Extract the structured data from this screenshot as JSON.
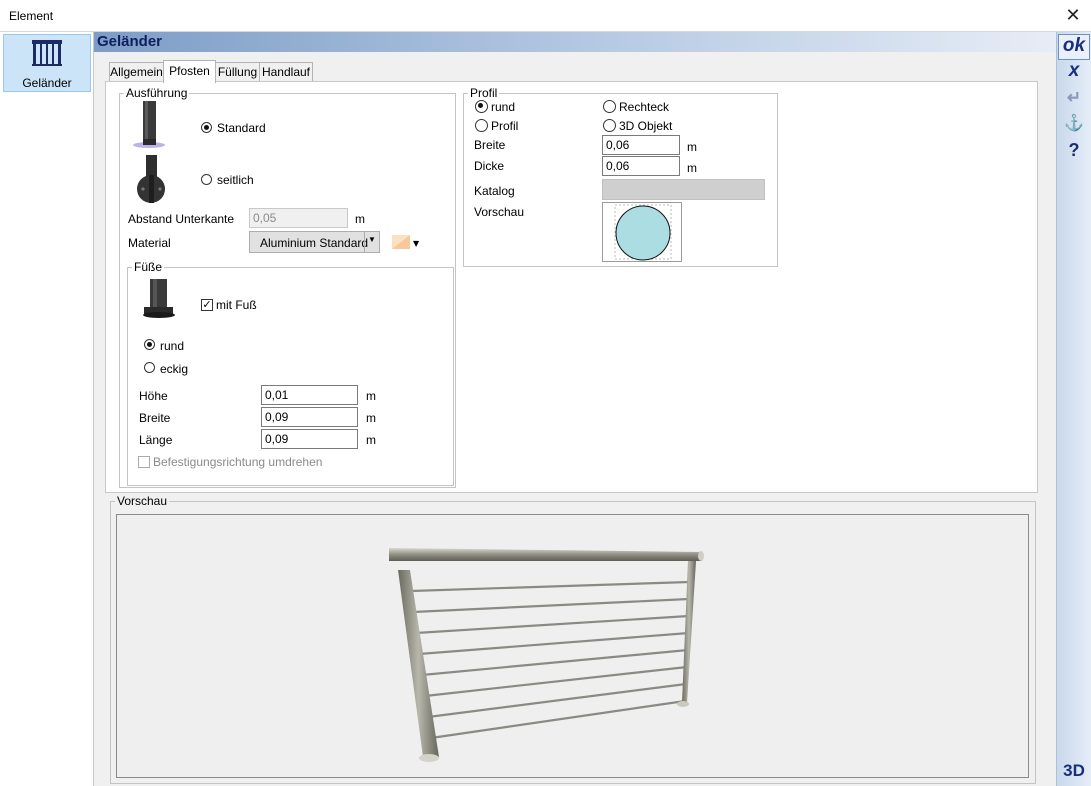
{
  "window": {
    "title": "Element",
    "close_glyph": "✕"
  },
  "sidebar": {
    "items": [
      {
        "label": "Geländer",
        "icon": "railing-icon"
      }
    ]
  },
  "header": {
    "title": "Geländer"
  },
  "tabs": [
    {
      "label": "Allgemein",
      "active": false
    },
    {
      "label": "Pfosten",
      "active": true
    },
    {
      "label": "Füllung",
      "active": false
    },
    {
      "label": "Handlauf",
      "active": false
    }
  ],
  "ausfuehrung": {
    "legend": "Ausführung",
    "options": [
      {
        "label": "Standard",
        "selected": true
      },
      {
        "label": "seitlich",
        "selected": false
      }
    ],
    "abstand_label": "Abstand Unterkante",
    "abstand_value": "0,05",
    "abstand_unit": "m",
    "material_label": "Material",
    "material_value": "Aluminium Standard"
  },
  "fuesse": {
    "legend": "Füße",
    "mit_fuss_label": "mit Fuß",
    "mit_fuss_checked": true,
    "shape_options": [
      {
        "label": "rund",
        "selected": true
      },
      {
        "label": "eckig",
        "selected": false
      }
    ],
    "fields": [
      {
        "label": "Höhe",
        "value": "0,01",
        "unit": "m"
      },
      {
        "label": "Breite",
        "value": "0,09",
        "unit": "m"
      },
      {
        "label": "Länge",
        "value": "0,09",
        "unit": "m"
      }
    ],
    "befestigung_label": "Befestigungsrichtung umdrehen",
    "befestigung_checked": false
  },
  "profil": {
    "legend": "Profil",
    "options": [
      {
        "label": "rund",
        "selected": true
      },
      {
        "label": "Rechteck",
        "selected": false
      },
      {
        "label": "Profil",
        "selected": false
      },
      {
        "label": "3D Objekt",
        "selected": false
      }
    ],
    "breite_label": "Breite",
    "breite_value": "0,06",
    "breite_unit": "m",
    "dicke_label": "Dicke",
    "dicke_value": "0,06",
    "dicke_unit": "m",
    "katalog_label": "Katalog",
    "katalog_value": "",
    "vorschau_label": "Vorschau"
  },
  "preview": {
    "legend": "Vorschau"
  },
  "toolbar": [
    {
      "name": "ok-button",
      "label": "ok"
    },
    {
      "name": "cancel-button",
      "label": "x"
    },
    {
      "name": "apply-button",
      "label": "↵"
    },
    {
      "name": "anchor-button",
      "label": "⚓"
    },
    {
      "name": "help-button",
      "label": "?"
    },
    {
      "name": "3d-button",
      "label": "3D"
    }
  ]
}
